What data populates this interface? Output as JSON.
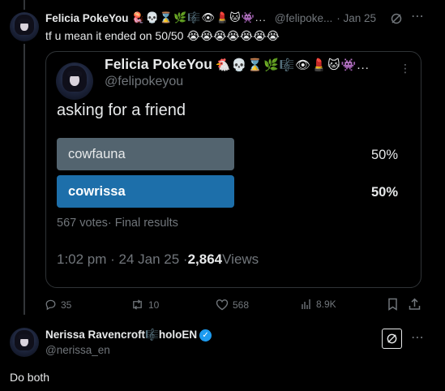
{
  "tweet1": {
    "author_name": "Felicia PokeYou",
    "author_emojis": "🪼💀⌛🌿🎼👁💄🐱👾...",
    "handle": "@felipoke...",
    "time": "· Jan 25",
    "text": "tf u mean it ended on 50/50 😭😭😭😭😭😭😭",
    "quote": {
      "author_name": "Felicia PokeYou",
      "author_emojis": "🐔💀⌛🌿🎼👁💄🐱👾...",
      "handle": "@felipokeyou",
      "text": "asking for a friend",
      "poll": {
        "options": [
          {
            "label": "cowfauna",
            "percent": "50%",
            "fraction": 0.5,
            "winner": false
          },
          {
            "label": "cowrissa",
            "percent": "50%",
            "fraction": 0.5,
            "winner": true
          }
        ],
        "votes": "567 votes",
        "status": "· Final results"
      },
      "timestamp": "1:02 pm · 24 Jan 25 · ",
      "views_count": "2,864",
      "views_label": " Views"
    },
    "actions": {
      "replies": "35",
      "reposts": "10",
      "likes": "568",
      "views": "8.9K"
    }
  },
  "tweet2": {
    "author_name": "Nerissa Ravencroft🎼holoEN",
    "handle": "@nerissa_en",
    "text": "Do both"
  },
  "colors": {
    "background": "#000000",
    "text": "#e7e9ea",
    "muted": "#71767b",
    "poll_winner": "#1d6faa",
    "poll_other": "#53646f",
    "verified": "#1d9bf0"
  }
}
